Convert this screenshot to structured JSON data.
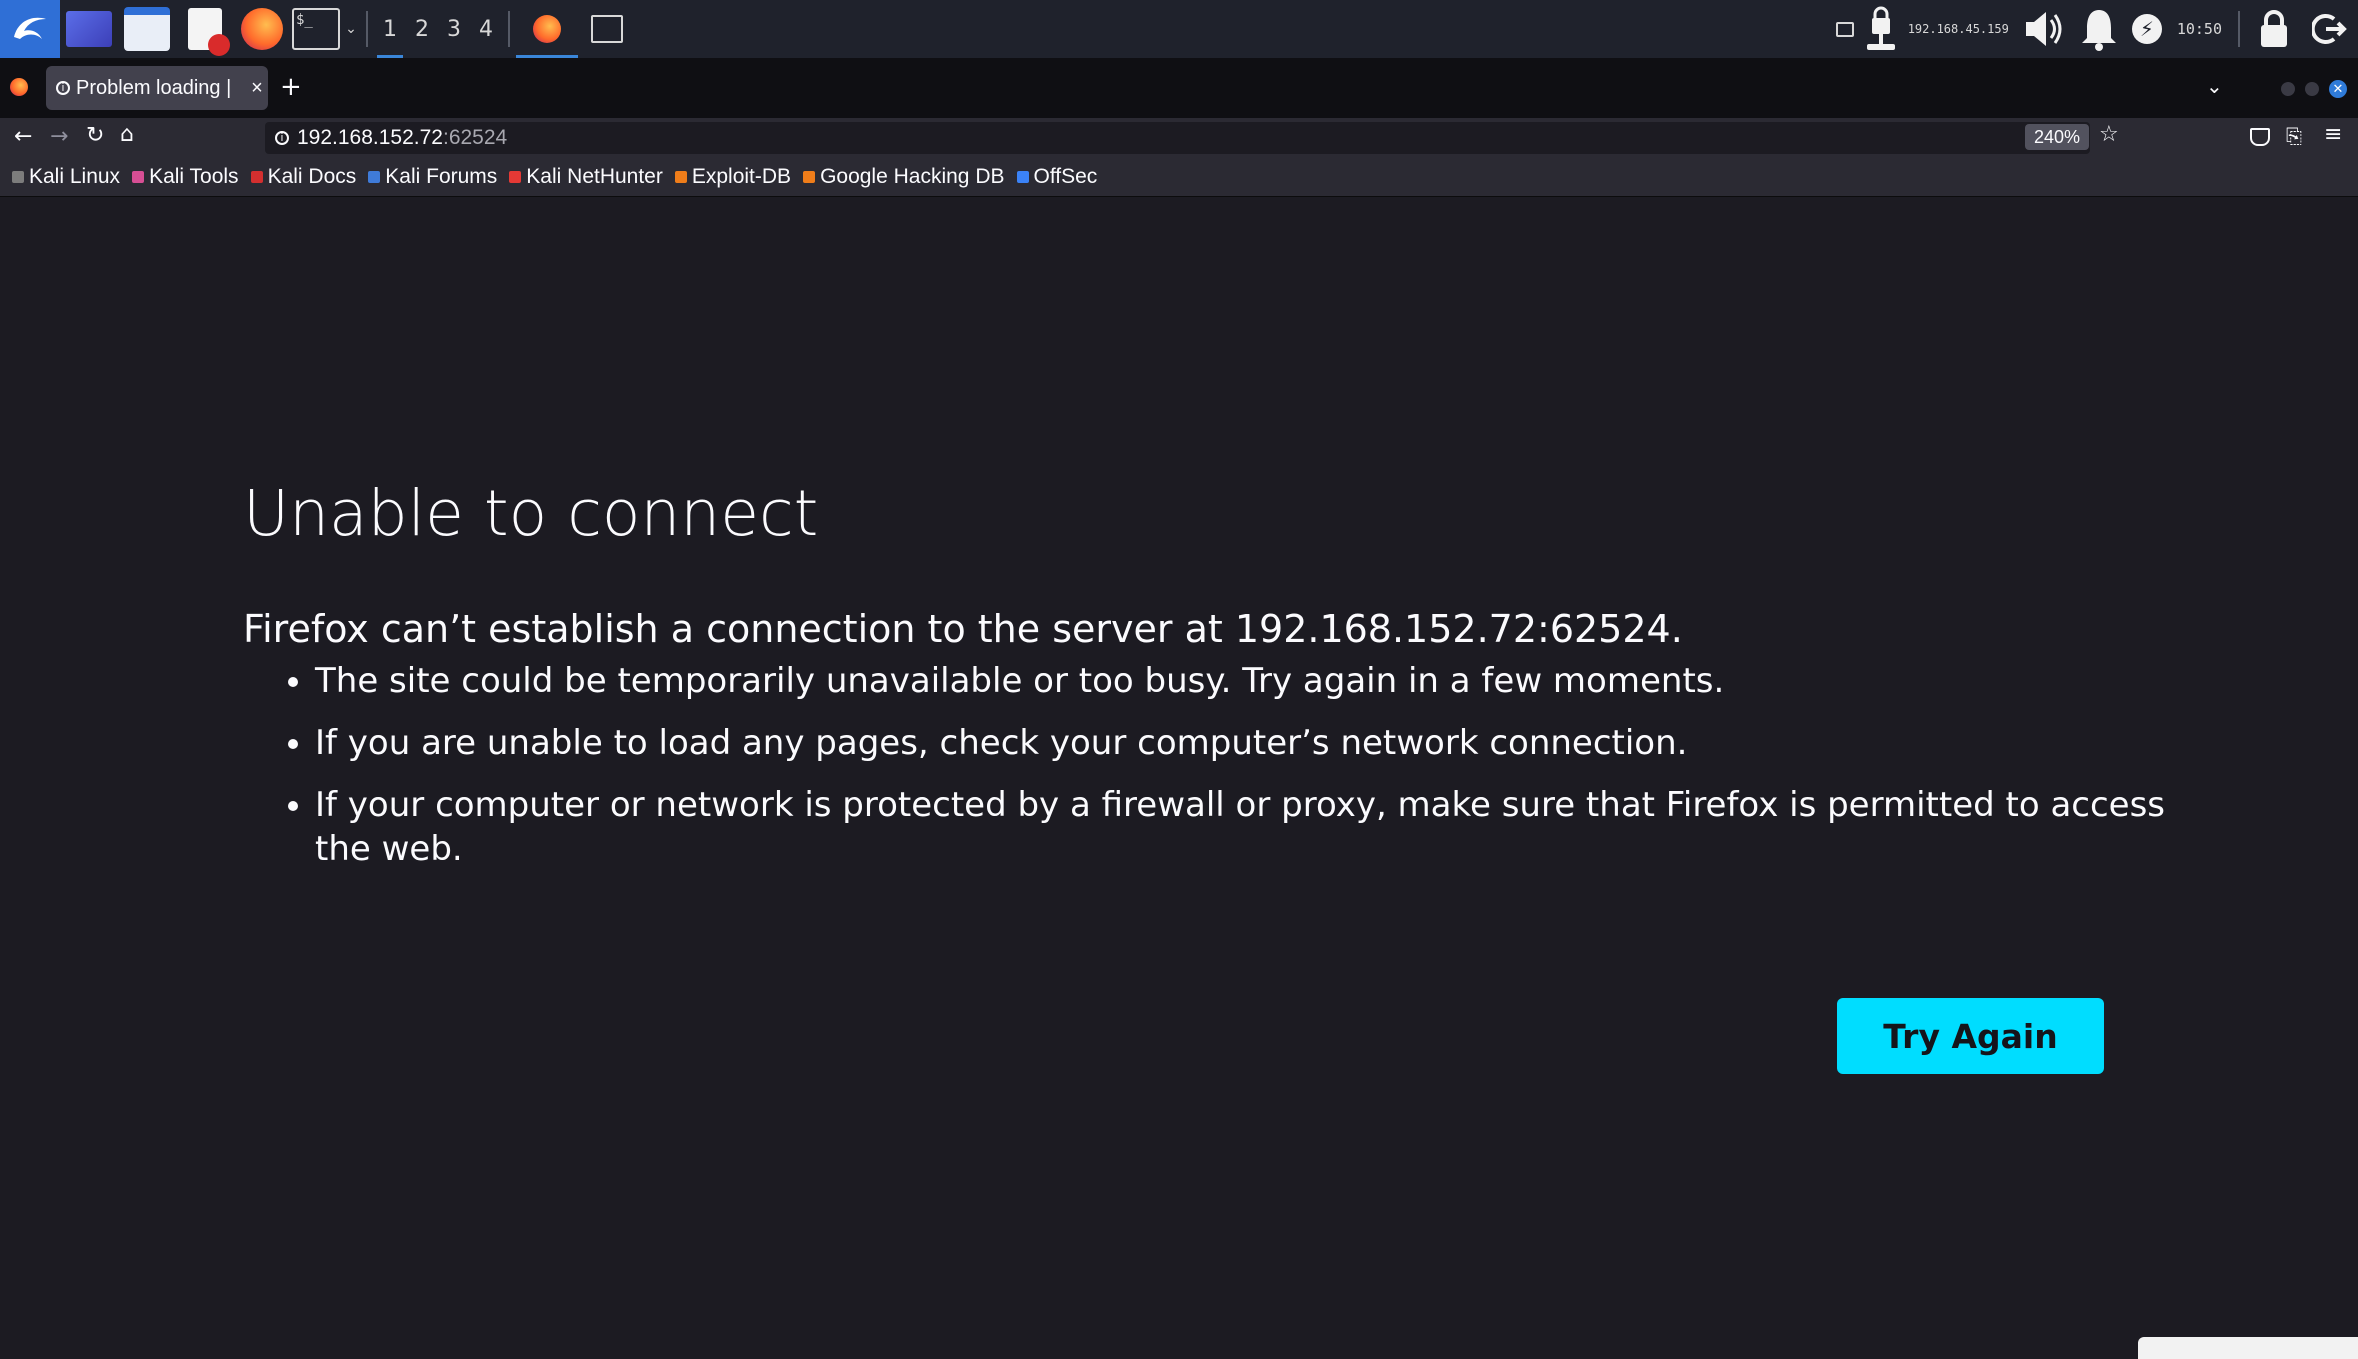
{
  "taskbar": {
    "workspaces": [
      "1",
      "2",
      "3",
      "4"
    ],
    "active_workspace": "1",
    "network_ip": "192.168.45.159",
    "clock": "10:50"
  },
  "browser": {
    "tab": {
      "title": "Problem loading |",
      "close": "×"
    },
    "new_tab": "+",
    "url": {
      "host": "192.168.152.72",
      "port": ":62524"
    },
    "zoom": "240%",
    "bookmarks": [
      {
        "label": "Kali Linux",
        "color": "#7c7c7c"
      },
      {
        "label": "Kali Tools",
        "color": "#d74e94"
      },
      {
        "label": "Kali Docs",
        "color": "#d32f2f"
      },
      {
        "label": "Kali Forums",
        "color": "#3f7bd9"
      },
      {
        "label": "Kali NetHunter",
        "color": "#e53935"
      },
      {
        "label": "Exploit-DB",
        "color": "#ef7d1a"
      },
      {
        "label": "Google Hacking DB",
        "color": "#ef7d1a"
      },
      {
        "label": "OffSec",
        "color": "#3b82f6"
      }
    ]
  },
  "error_page": {
    "title": "Unable to connect",
    "description": "Firefox can’t establish a connection to the server at 192.168.152.72:62524.",
    "reasons": [
      "The site could be temporarily unavailable or too busy. Try again in a few moments.",
      "If you are unable to load any pages, check your computer’s network connection.",
      "If your computer or network is protected by a firewall or proxy, make sure that Firefox is permitted to access the web."
    ],
    "button": "Try Again"
  },
  "colors": {
    "accent": "#00ddff",
    "background": "#1c1b22",
    "chrome": "#2b2a33"
  }
}
